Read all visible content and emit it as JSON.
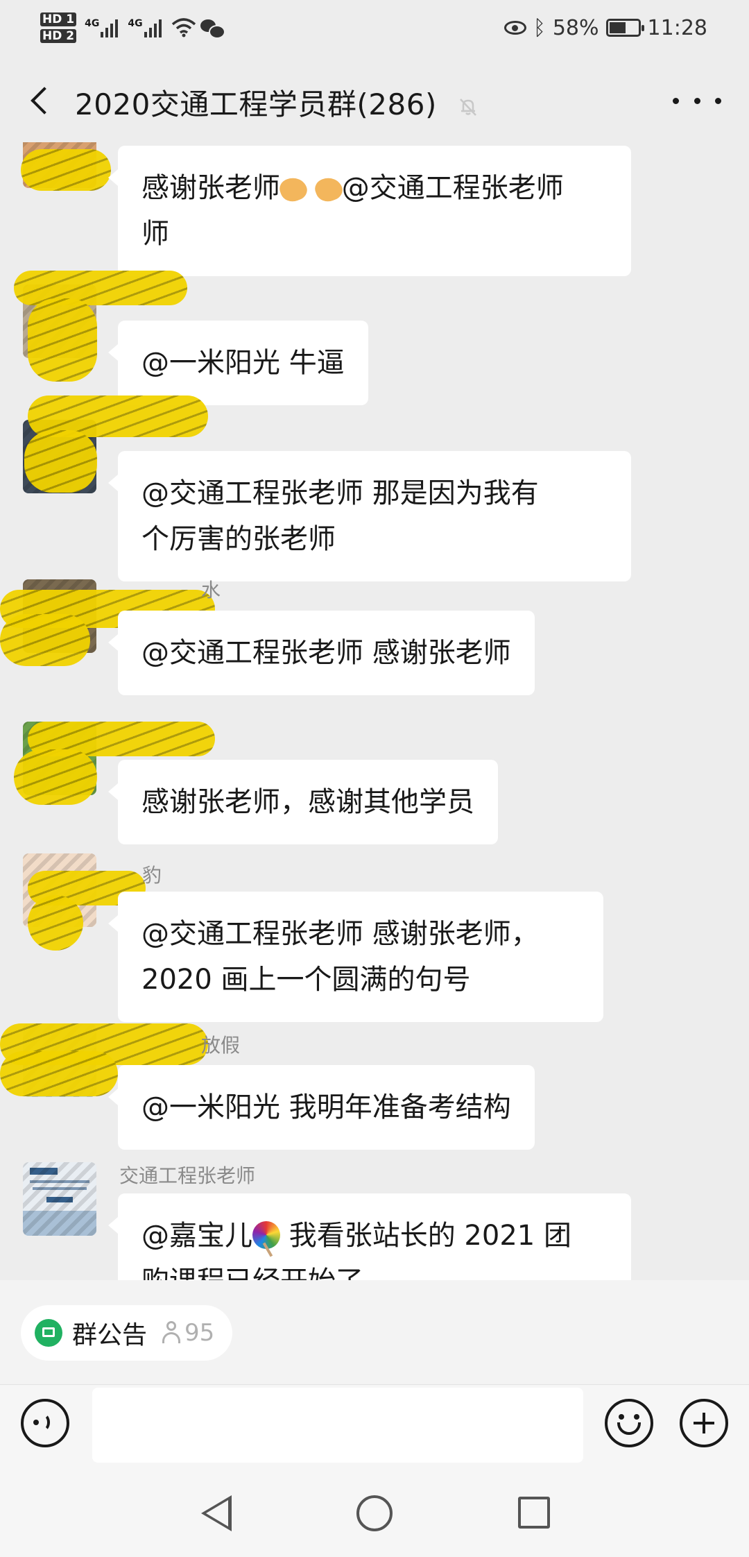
{
  "status_bar": {
    "hd1": "HD 1",
    "hd2": "HD 2",
    "net1": "4G",
    "net2": "4G",
    "battery_percent": "58%",
    "battery_level": 0.58,
    "time": "11:28"
  },
  "header": {
    "title": "2020交通工程学员群(286)"
  },
  "messages": [
    {
      "sender": "",
      "text": "感谢张老师",
      "text_after_emoji": "@交通工程张老师",
      "text_line2": "师"
    },
    {
      "sender": "",
      "text": "@一米阳光  牛逼"
    },
    {
      "sender": "",
      "text": "@交通工程张老师  那是因为我有",
      "text_line2": "个厉害的张老师"
    },
    {
      "sender": "水",
      "text": "@交通工程张老师  感谢张老师"
    },
    {
      "sender": "",
      "text": "感谢张老师，感谢其他学员"
    },
    {
      "sender": "豹",
      "text": "@交通工程张老师  感谢张老师，",
      "text_line2": "2020 画上一个圆满的句号"
    },
    {
      "sender": "放假",
      "text": "@一米阳光  我明年准备考结构"
    },
    {
      "sender": "交通工程张老师",
      "text": "@嘉宝儿",
      "text_after_emoji": " 我看张站长的 2021 团",
      "text_line2": "购课程已经开始了"
    }
  ],
  "announcement": {
    "label": "群公告",
    "member_count": "95"
  },
  "input": {
    "placeholder": ""
  },
  "colors": {
    "background": "#ededed",
    "bubble": "#ffffff",
    "accent_green": "#20b161",
    "mask_yellow": "#f2d300"
  }
}
